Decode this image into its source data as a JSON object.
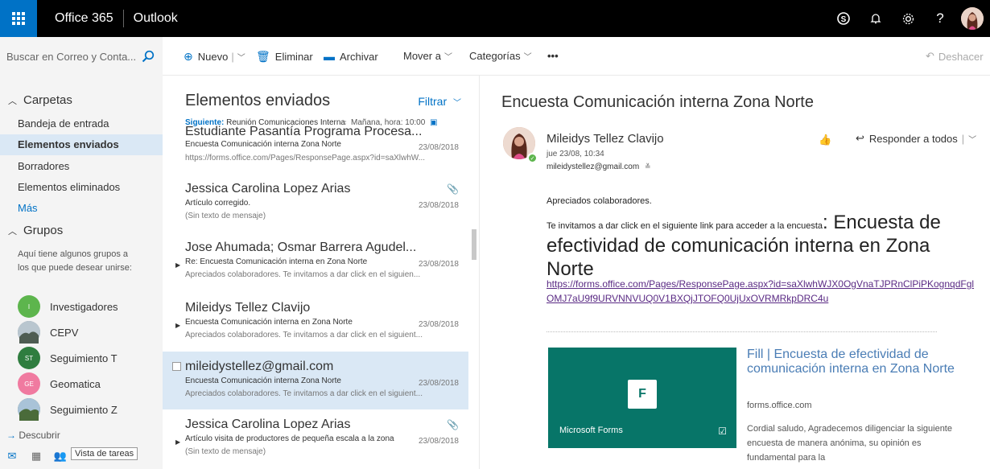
{
  "topbar": {
    "suite": "Office 365",
    "app": "Outlook"
  },
  "commands": {
    "search_placeholder": "Buscar en Correo y Conta...",
    "new": "Nuevo",
    "delete": "Eliminar",
    "archive": "Archivar",
    "move": "Mover a",
    "categories": "Categorías",
    "more": "•••",
    "undo": "Deshacer"
  },
  "folders": {
    "header": "Carpetas",
    "items": [
      "Bandeja de entrada",
      "Elementos enviados",
      "Borradores",
      "Elementos eliminados"
    ],
    "more": "Más",
    "groups_header": "Grupos",
    "groups_desc": "Aquí tiene algunos grupos a los que puede desear unirse:",
    "groups": [
      {
        "name": "Investigadores",
        "initials": "I",
        "color": "#5db54d"
      },
      {
        "name": "CEPV",
        "initials": "",
        "color": "#6b7a8a"
      },
      {
        "name": "Seguimiento T",
        "initials": "ST",
        "color": "#2f7d3f"
      },
      {
        "name": "Geomatica",
        "initials": "GE",
        "color": "#e8668c"
      },
      {
        "name": "Seguimiento Z",
        "initials": "",
        "color": "#5d6f55"
      }
    ],
    "discover": "Descubrir",
    "tooltip": "Vista de tareas"
  },
  "list": {
    "title": "Elementos enviados",
    "filter": "Filtrar",
    "next_label": "Siguiente:",
    "next_event": "Reunión Comunicaciones Internas",
    "next_time": "Mañana, hora: 10:00",
    "messages": [
      {
        "from": "Estudiante Pasantía Programa Procesa...",
        "subject": "Encuesta Comunicación interna Zona Norte",
        "date": "23/08/2018",
        "preview": "https://forms.office.com/Pages/ResponsePage.aspx?id=saXlwhW..."
      },
      {
        "from": "Jessica Carolina Lopez Arias",
        "subject": "Artículo corregido.",
        "date": "23/08/2018",
        "preview": "(Sin texto de mensaje)"
      },
      {
        "from": "Jose Ahumada; Osmar Barrera Agudel...",
        "subject": "Re: Encuesta Comunicación interna en Zona Norte",
        "date": "23/08/2018",
        "preview": "Apreciados colaboradores.  Te invitamos a dar click en el siguien..."
      },
      {
        "from": "Mileidys Tellez Clavijo",
        "subject": "Encuesta Comunicación interna en Zona Norte",
        "date": "23/08/2018",
        "preview": "Apreciados colaboradores.  Te invitamos a dar click en el siguient..."
      },
      {
        "from": "mileidystellez@gmail.com",
        "subject": "Encuesta Comunicación interna Zona Norte",
        "date": "23/08/2018",
        "preview": "Apreciados colaboradores.  Te invitamos a dar click en el siguient..."
      },
      {
        "from": "Jessica Carolina Lopez Arias",
        "subject": "Artículo visita de productores de pequeña escala a la zona",
        "date": "23/08/2018",
        "preview": "(Sin texto de mensaje)"
      }
    ]
  },
  "reading": {
    "subject": "Encuesta Comunicación interna Zona Norte",
    "sender": "Mileidys Tellez Clavijo",
    "date": "jue 23/08, 10:34",
    "email": "mileidystellez@gmail.com",
    "reply_all": "Responder a todos",
    "greeting": "Apreciados colaboradores.",
    "invite": "Te invitamos a dar click en el siguiente link para acceder a la encuesta",
    "survey_title": ": Encuesta de efectividad de comunicación interna en Zona Norte",
    "link": "https://forms.office.com/Pages/ResponsePage.aspx?id=saXlwhWJX0OgVnaTJPRnClPiPKognqdFglOMJ7aU9f9URVNNVUQ0V1BXQjJTOFQ0UjUxOVRMRkpDRC4u",
    "card_brand": "Microsoft Forms",
    "card_title": "Fill | Encuesta de efectividad de comunicación interna en Zona Norte",
    "card_domain": "forms.office.com",
    "card_desc": "Cordial saludo, Agradecemos diligenciar la siguiente encuesta de manera anónima, su opinión es fundamental para la"
  }
}
